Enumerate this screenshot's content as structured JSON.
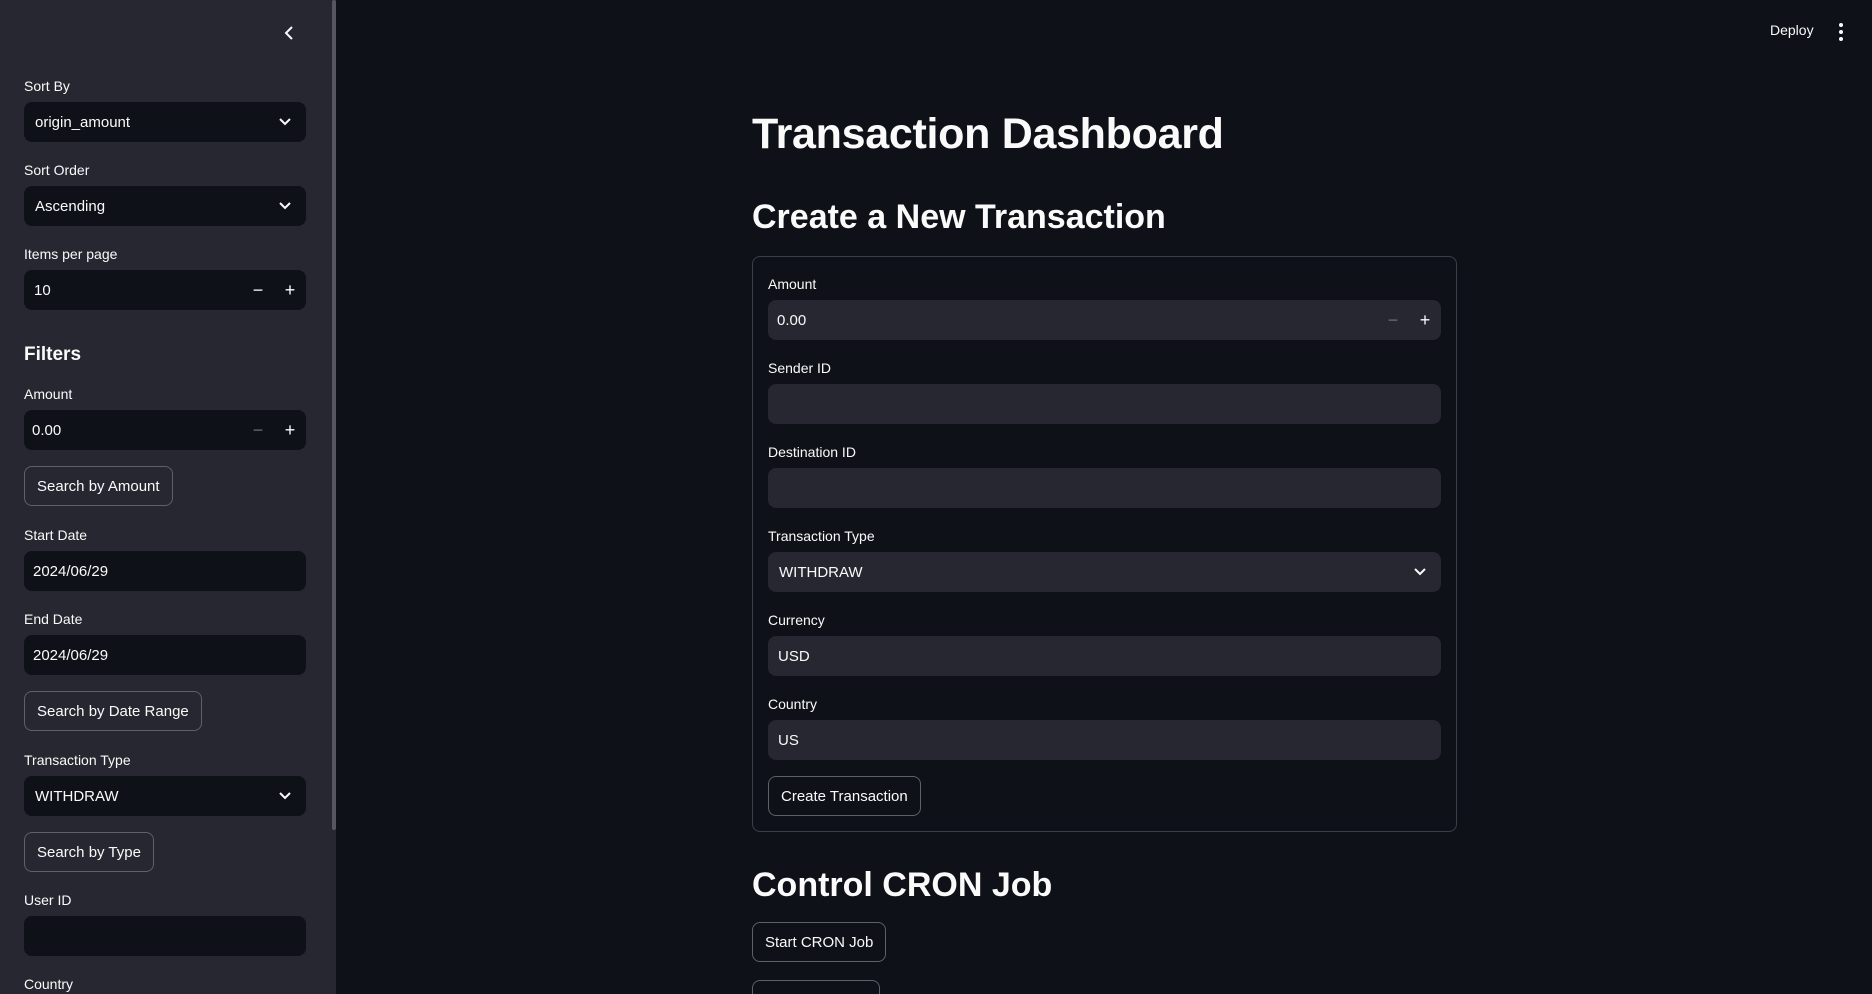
{
  "sidebar": {
    "sort_by": {
      "label": "Sort By",
      "value": "origin_amount"
    },
    "sort_order": {
      "label": "Sort Order",
      "value": "Ascending"
    },
    "items_per_page": {
      "label": "Items per page",
      "value": "10"
    },
    "filters_heading": "Filters",
    "amount": {
      "label": "Amount",
      "value": "0.00"
    },
    "search_amount_button": "Search by Amount",
    "start_date": {
      "label": "Start Date",
      "value": "2024/06/29"
    },
    "end_date": {
      "label": "End Date",
      "value": "2024/06/29"
    },
    "search_date_button": "Search by Date Range",
    "transaction_type": {
      "label": "Transaction Type",
      "value": "WITHDRAW"
    },
    "search_type_button": "Search by Type",
    "user_id": {
      "label": "User ID",
      "value": ""
    },
    "country": {
      "label": "Country"
    },
    "icons": {
      "collapse": "chevron-left-icon",
      "dropdown": "chevron-down-icon",
      "minus": "minus-icon",
      "plus": "plus-icon"
    }
  },
  "header": {
    "deploy_label": "Deploy",
    "menu_icon": "kebab-menu-icon"
  },
  "main": {
    "title": "Transaction Dashboard",
    "create_section": {
      "heading": "Create a New Transaction",
      "amount": {
        "label": "Amount",
        "value": "0.00"
      },
      "sender_id": {
        "label": "Sender ID",
        "value": ""
      },
      "destination_id": {
        "label": "Destination ID",
        "value": ""
      },
      "transaction_type": {
        "label": "Transaction Type",
        "value": "WITHDRAW"
      },
      "currency": {
        "label": "Currency",
        "value": "USD"
      },
      "country": {
        "label": "Country",
        "value": "US"
      },
      "submit_label": "Create Transaction"
    },
    "cron_section": {
      "heading": "Control CRON Job",
      "start_label": "Start CRON Job"
    }
  },
  "colors": {
    "background": "#0e1117",
    "sidebar": "#262730",
    "input_dark": "#0e1117",
    "input_light": "#262730",
    "text": "#fafafa",
    "border": "#5e606a"
  }
}
